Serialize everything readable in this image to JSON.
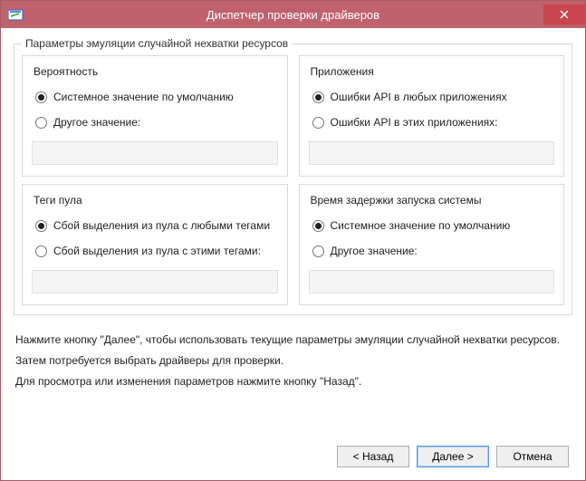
{
  "window": {
    "title": "Диспетчер проверки драйверов"
  },
  "outer_group": {
    "legend": "Параметры эмуляции случайной нехватки ресурсов"
  },
  "groups": {
    "probability": {
      "title": "Вероятность",
      "opt1": "Системное значение по умолчанию",
      "opt2": "Другое значение:",
      "selected": 1,
      "value": ""
    },
    "applications": {
      "title": "Приложения",
      "opt1": "Ошибки API в любых приложениях",
      "opt2": "Ошибки API в этих приложениях:",
      "selected": 1,
      "value": ""
    },
    "pooltags": {
      "title": "Теги пула",
      "opt1": "Сбой выделения из пула с любыми тегами",
      "opt2": "Сбой выделения из пула с этими тегами:",
      "selected": 1,
      "value": ""
    },
    "delay": {
      "title": "Время задержки запуска системы",
      "opt1": "Системное значение по умолчанию",
      "opt2": "Другое значение:",
      "selected": 1,
      "value": ""
    }
  },
  "instructions": {
    "line1": "Нажмите кнопку \"Далее\", чтобы использовать текущие параметры эмуляции случайной нехватки ресурсов.",
    "line2": "Затем потребуется выбрать драйверы для проверки.",
    "line3": "Для просмотра или изменения параметров нажмите кнопку \"Назад\"."
  },
  "buttons": {
    "back": "< Назад",
    "next": "Далее >",
    "cancel": "Отмена"
  }
}
